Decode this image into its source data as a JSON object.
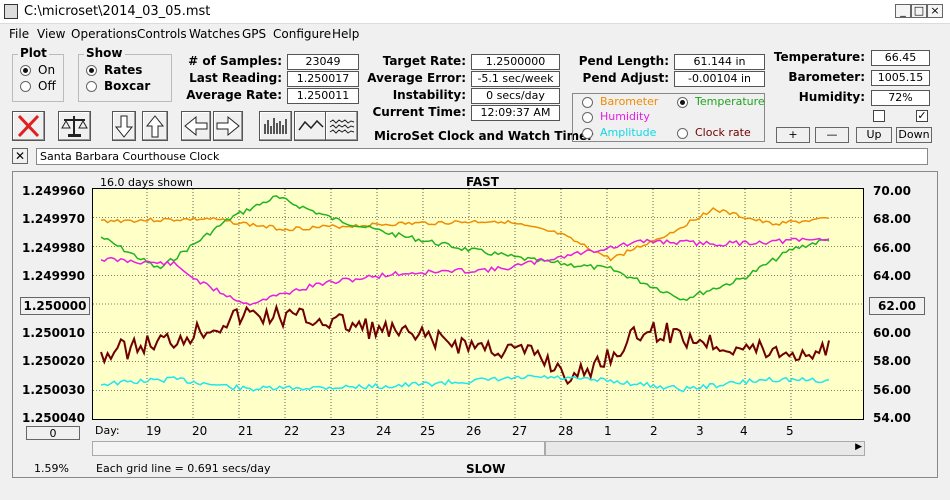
{
  "window": {
    "title": "C:\\microset\\2014_03_05.mst"
  },
  "menu": [
    "File",
    "View",
    "Operations",
    "Controls",
    "Watches",
    "GPS",
    "Configure",
    "Help"
  ],
  "plot_group": {
    "title": "Plot",
    "on": "On",
    "off": "Off"
  },
  "show_group": {
    "title": "Show",
    "rates": "Rates",
    "boxcar": "Boxcar"
  },
  "stats": {
    "samples_label": "# of Samples:",
    "samples": "23049",
    "last_label": "Last Reading:",
    "last": "1.250017",
    "avg_rate_label": "Average Rate:",
    "avg_rate": "1.250011",
    "target_label": "Target Rate:",
    "target": "1.2500000",
    "avg_err_label": "Average Error:",
    "avg_err": "-5.1 sec/week",
    "instab_label": "Instability:",
    "instab": "0 secs/day",
    "time_label": "Current Time:",
    "time": "12:09:37 AM",
    "pend_len_label": "Pend Length:",
    "pend_len": "61.144 in",
    "pend_adj_label": "Pend Adjust:",
    "pend_adj": "-0.00104 in",
    "temp_label": "Temperature:",
    "temp": "66.45",
    "baro_label": "Barometer:",
    "baro": "1005.15",
    "humid_label": "Humidity:",
    "humid": "72%"
  },
  "app_caption": "MicroSet Clock and Watch Timer",
  "channels": {
    "barometer": "Barometer",
    "temperature": "Temperature",
    "humidity": "Humidity",
    "amplitude": "Amplitude",
    "clock_rate": "Clock rate"
  },
  "small_buttons": {
    "plus": "+",
    "minus": "—",
    "up": "Up",
    "down": "Down"
  },
  "clock_name": "Santa Barbara Courthouse Clock",
  "plot": {
    "days_shown": "16.0 days shown",
    "fast": "FAST",
    "slow": "SLOW",
    "grid_note": "Each grid line = 0.691 secs/day",
    "percent": "1.59%",
    "center_value": "1.250000",
    "right_center": "62.00",
    "scroll_value": "0",
    "day_label": "Day:",
    "left_ticks": [
      "1.249960",
      "1.249970",
      "1.249980",
      "1.249990",
      "1.250000",
      "1.250010",
      "1.250020",
      "1.250030",
      "1.250040"
    ],
    "right_ticks": [
      "70.00",
      "68.00",
      "66.00",
      "64.00",
      "62.00",
      "60.00",
      "58.00",
      "56.00",
      "54.00"
    ],
    "days": [
      "19",
      "20",
      "21",
      "22",
      "23",
      "24",
      "25",
      "26",
      "27",
      "28",
      "1",
      "2",
      "3",
      "4",
      "5"
    ]
  },
  "colors": {
    "plot_bg": "#ffffc8",
    "barometer": "#f08c00",
    "temperature": "#1fb41f",
    "humidity": "#e61ee6",
    "amplitude": "#1ee6f0",
    "clock_rate": "#700000"
  }
}
